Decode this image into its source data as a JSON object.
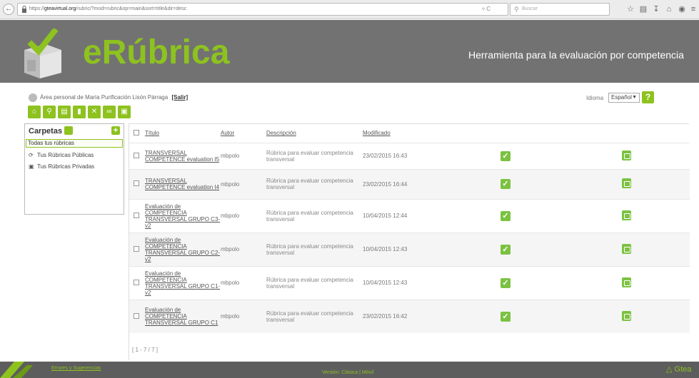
{
  "browser": {
    "url_prefix": "https://",
    "url_host": "gteavirtual.org",
    "url_path": "/rubric/?mod=rubric&op=main&sort=title&dir=desc",
    "search_placeholder": "Buscar"
  },
  "header": {
    "brand": "eRúbrica",
    "tagline": "Herramienta para la evaluación por competencia"
  },
  "userbar": {
    "text": "Área personal de María Purificación Lisón Párraga",
    "logout": "[Salir]"
  },
  "language": {
    "label": "Idioma",
    "selected": "Español",
    "help": "?"
  },
  "toolbar": {
    "buttons": [
      {
        "name": "home-button",
        "icon": "home-icon",
        "glyph": "⌂",
        "color": "#8dc21f"
      },
      {
        "name": "search-button",
        "icon": "search-icon",
        "glyph": "⚲",
        "color": "#8dc21f"
      },
      {
        "name": "new-rubric-button",
        "icon": "new-document-icon",
        "glyph": "▤",
        "color": "#8dc21f"
      },
      {
        "name": "export-pdf-button",
        "icon": "pdf-icon",
        "glyph": "▮",
        "color": "#8dc21f"
      },
      {
        "name": "delete-button",
        "icon": "delete-icon",
        "glyph": "✕",
        "color": "#8dc21f"
      },
      {
        "name": "link-button",
        "icon": "link-icon",
        "glyph": "∞",
        "color": "#8dc21f"
      },
      {
        "name": "print-button",
        "icon": "print-icon",
        "glyph": "▣",
        "color": "#8dc21f"
      }
    ]
  },
  "sidebar": {
    "title": "Carpetas",
    "selected": "Todas tus rúbricas",
    "folders": [
      {
        "label": "Tus Rúbricas Públicas",
        "icon": "public-folder-icon",
        "glyph": "⟳"
      },
      {
        "label": "Tus Rúbricas Privadas",
        "icon": "private-folder-icon",
        "glyph": "🔒"
      }
    ]
  },
  "table": {
    "headers": {
      "title": "Título",
      "author": "Autor",
      "description": "Descripción",
      "modified": "Modificado"
    },
    "rows": [
      {
        "title": "TRANSVERSAL COMPETENCE evaluation I5",
        "author": "mbpolo",
        "description": "Rúbrica para evaluar competencia transversal",
        "modified": "23/02/2015 16:43"
      },
      {
        "title": "TRANSVERSAL COMPETENCE evaluation I4",
        "author": "mbpolo",
        "description": "Rúbrica para evaluar competencia transversal",
        "modified": "23/02/2015 16:44"
      },
      {
        "title": "Evaluación de COMPETENCIA TRANSVERSAL GRUPO C3-v2",
        "author": "mbpolo",
        "description": "Rúbrica para evaluar competencia transversal",
        "modified": "10/04/2015 12:44"
      },
      {
        "title": "Evaluación de COMPETENCIA TRANSVERSAL GRUPO C2-v2",
        "author": "mbpolo",
        "description": "Rúbrica para evaluar competencia transversal",
        "modified": "10/04/2015 12:43"
      },
      {
        "title": "Evaluación de COMPETENCIA TRANSVERSAL GRUPO C1-v2",
        "author": "mbpolo",
        "description": "Rúbrica para evaluar competencia transversal",
        "modified": "10/04/2015 12:43"
      },
      {
        "title": "Evaluación de COMPETENCIA TRANSVERSAL GRUPO C1",
        "author": "mbpolo",
        "description": "Rúbrica para evaluar competencia transversal",
        "modified": "23/02/2015 16:42"
      }
    ],
    "pager": "[ 1 - 7 / 7 ]"
  },
  "footer": {
    "left": "Errores y Sugerencias",
    "center": "Versión: Clásica | Móvil",
    "right": "Gtea"
  }
}
